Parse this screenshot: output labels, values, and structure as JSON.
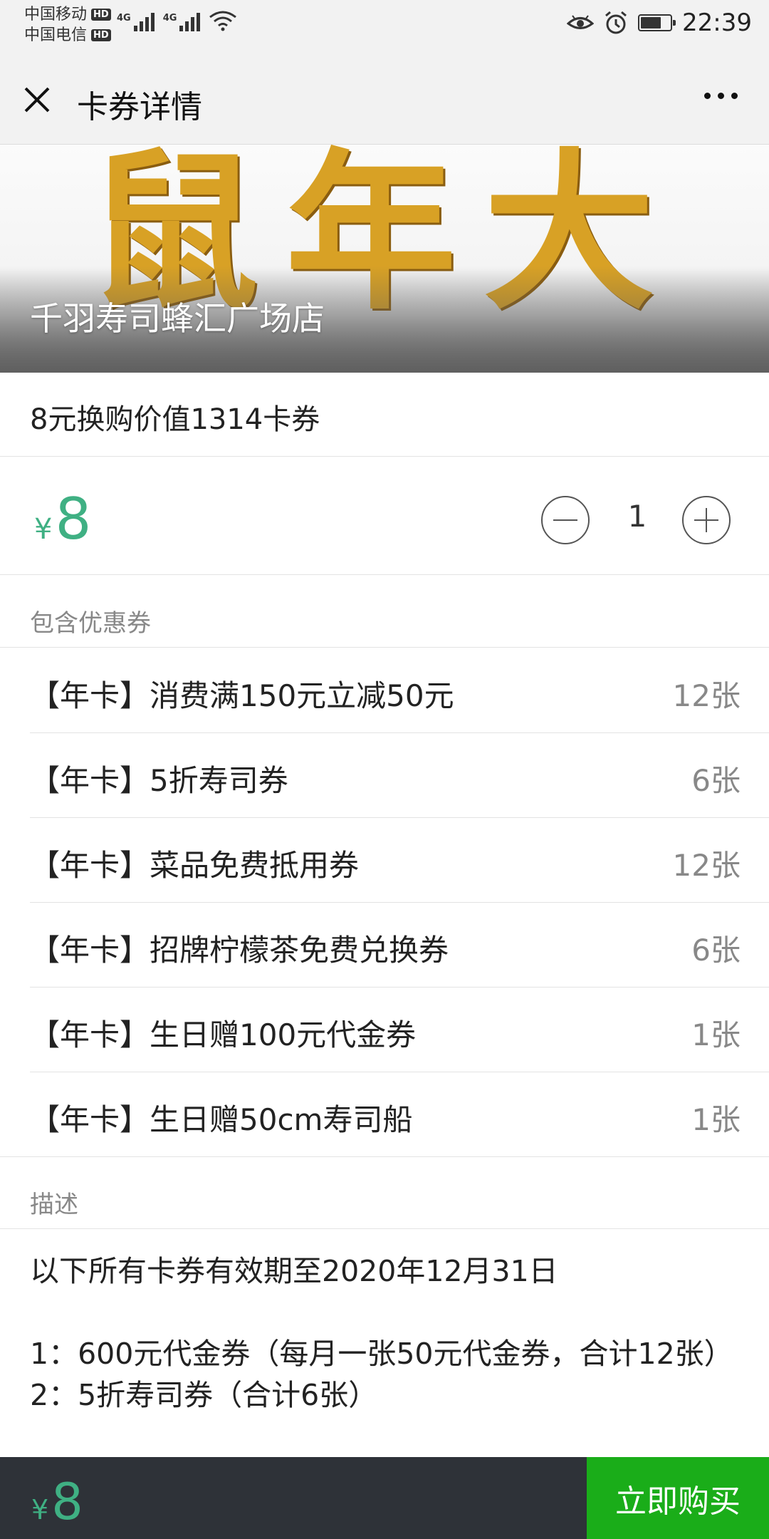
{
  "status_bar": {
    "carrier_1": "中国移动",
    "carrier_2": "中国电信",
    "hd_badge": "HD",
    "network_1": "4G",
    "network_2": "4G",
    "time": "22:39",
    "icons": [
      "eye-icon",
      "alarm-icon",
      "battery-icon"
    ],
    "battery_level": 0.7
  },
  "nav": {
    "title": "卡券详情",
    "close_icon": "close-icon",
    "more_icon": "more-icon"
  },
  "banner": {
    "art_text": "鼠年大吉",
    "store_name": "千羽寿司蜂汇广场店"
  },
  "product": {
    "title": "8元换购价值1314卡券",
    "currency": "¥",
    "price": "8",
    "quantity": "1"
  },
  "coupons": {
    "header": "包含优惠券",
    "items": [
      {
        "name": "【年卡】消费满150元立减50元",
        "count": "12张"
      },
      {
        "name": "【年卡】5折寿司券",
        "count": "6张"
      },
      {
        "name": "【年卡】菜品免费抵用券",
        "count": "12张"
      },
      {
        "name": "【年卡】招牌柠檬茶免费兑换券",
        "count": "6张"
      },
      {
        "name": "【年卡】生日赠100元代金券",
        "count": "1张"
      },
      {
        "name": "【年卡】生日赠50cm寿司船",
        "count": "1张"
      }
    ]
  },
  "description": {
    "header": "描述",
    "line_1": "以下所有卡券有效期至2020年12月31日",
    "line_2": "1：600元代金券（每月一张50元代金券，合计12张）",
    "line_3": "2：5折寿司券（合计6张）"
  },
  "bottom_bar": {
    "currency": "¥",
    "price": "8",
    "buy_label": "立即购买"
  },
  "colors": {
    "accent_green": "#3fb083",
    "buy_button": "#1aad19",
    "bottom_bar": "#2e3238",
    "nav_background": "#f2f2f2"
  }
}
